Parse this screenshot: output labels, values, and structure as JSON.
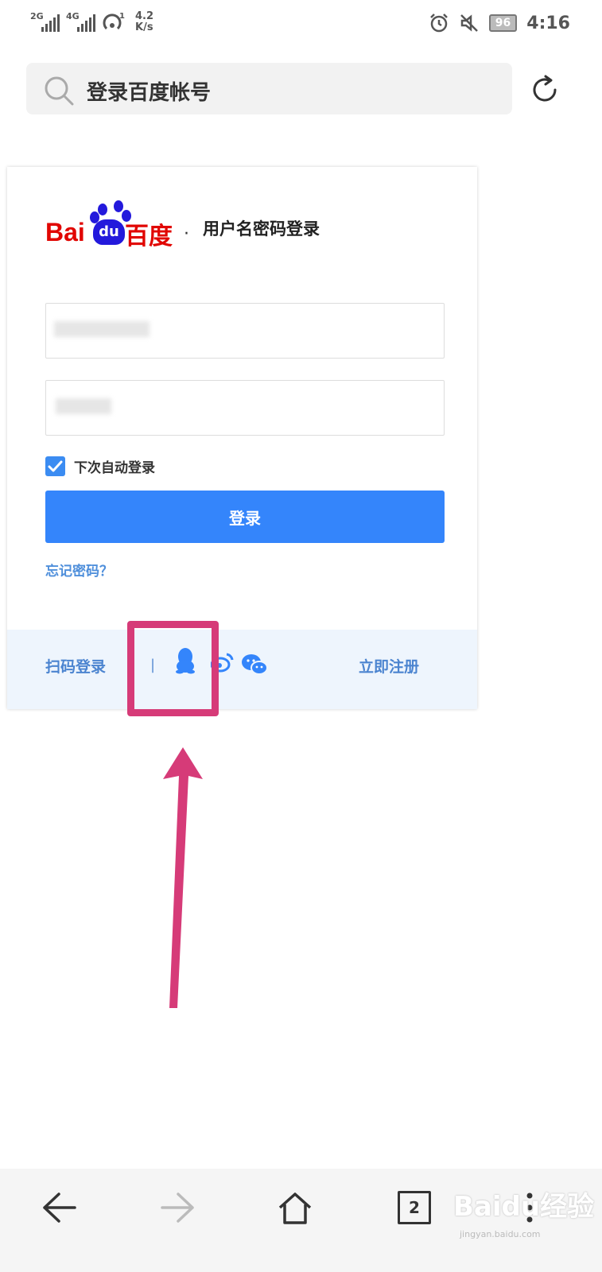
{
  "status_bar": {
    "net1": "2G",
    "net2": "4G",
    "hotspot_count": "1",
    "speed": "4.2",
    "speed_unit": "K/s",
    "battery": "96",
    "time": "4:16"
  },
  "address_bar": {
    "title": "登录百度帐号"
  },
  "login_card": {
    "logo_text_bai": "Bai",
    "logo_text_du": "du",
    "logo_text_cn": "百度",
    "separator": "·",
    "title": "用户名密码登录",
    "remember_label": "下次自动登录",
    "remember_checked": true,
    "login_button": "登录",
    "forgot_link": "忘记密码？",
    "footer": {
      "scan_login": "扫码登录",
      "divider": "|",
      "register": "立即注册"
    }
  },
  "watermark": {
    "text": "Baidu经验",
    "sub": "jingyan.baidu.com"
  },
  "colors": {
    "primary_blue": "#3485fb",
    "link_blue": "#4b84d0",
    "baidu_red": "#e10602",
    "baidu_blue": "#2319dc",
    "highlight_pink": "#d63b78",
    "footer_bg": "#eef5fd"
  },
  "icons": {
    "qq": "qq-icon",
    "weibo": "weibo-icon",
    "wechat": "wechat-icon",
    "search": "search-icon",
    "refresh": "refresh-icon",
    "back": "back-arrow-icon",
    "forward": "forward-arrow-icon",
    "home": "home-icon",
    "tabs": "tabs-icon",
    "menu": "menu-icon"
  },
  "bottom_nav": {
    "tab_count": "2"
  }
}
